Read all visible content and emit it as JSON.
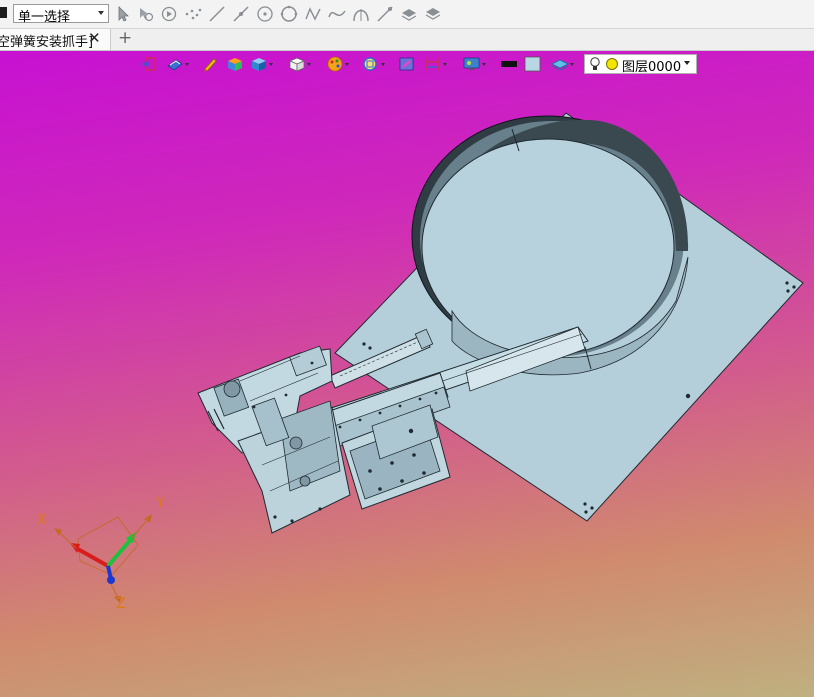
{
  "selection_toolbar": {
    "filter_value": "单一选择",
    "tools": [
      "pointer-icon",
      "smart-pick-icon",
      "play-icon",
      "point-cloud-icon",
      "line-icon",
      "line-point-icon",
      "circle-center-icon",
      "circle-icon",
      "curve-icon",
      "spline-icon",
      "arc-icon",
      "tangent-line-icon",
      "layer-stack-icon",
      "layer-stack-alt-icon"
    ]
  },
  "tabs": {
    "active_title": "空弹簧安装抓手]",
    "new_tab_symbol": "+"
  },
  "view_toolbar": {
    "layer_value": "图层0000",
    "buttons": [
      "exit-icon",
      "view-orient-icon",
      "edit-pencil-icon",
      "shaded-box-icon",
      "render-mode-icon",
      "wireframe-box-icon",
      "palette-icon",
      "zoom-icon",
      "section-icon",
      "dimension-icon",
      "display-icon",
      "color-black-icon",
      "color-swatch-icon",
      "layer-icon"
    ]
  },
  "triad": {
    "x_label": "X",
    "y_label": "Y",
    "z_label": "Z"
  },
  "colors": {
    "part_fill": "#b5d0db",
    "viewport_top": "#c711d2",
    "viewport_bottom": "#bfb080"
  }
}
